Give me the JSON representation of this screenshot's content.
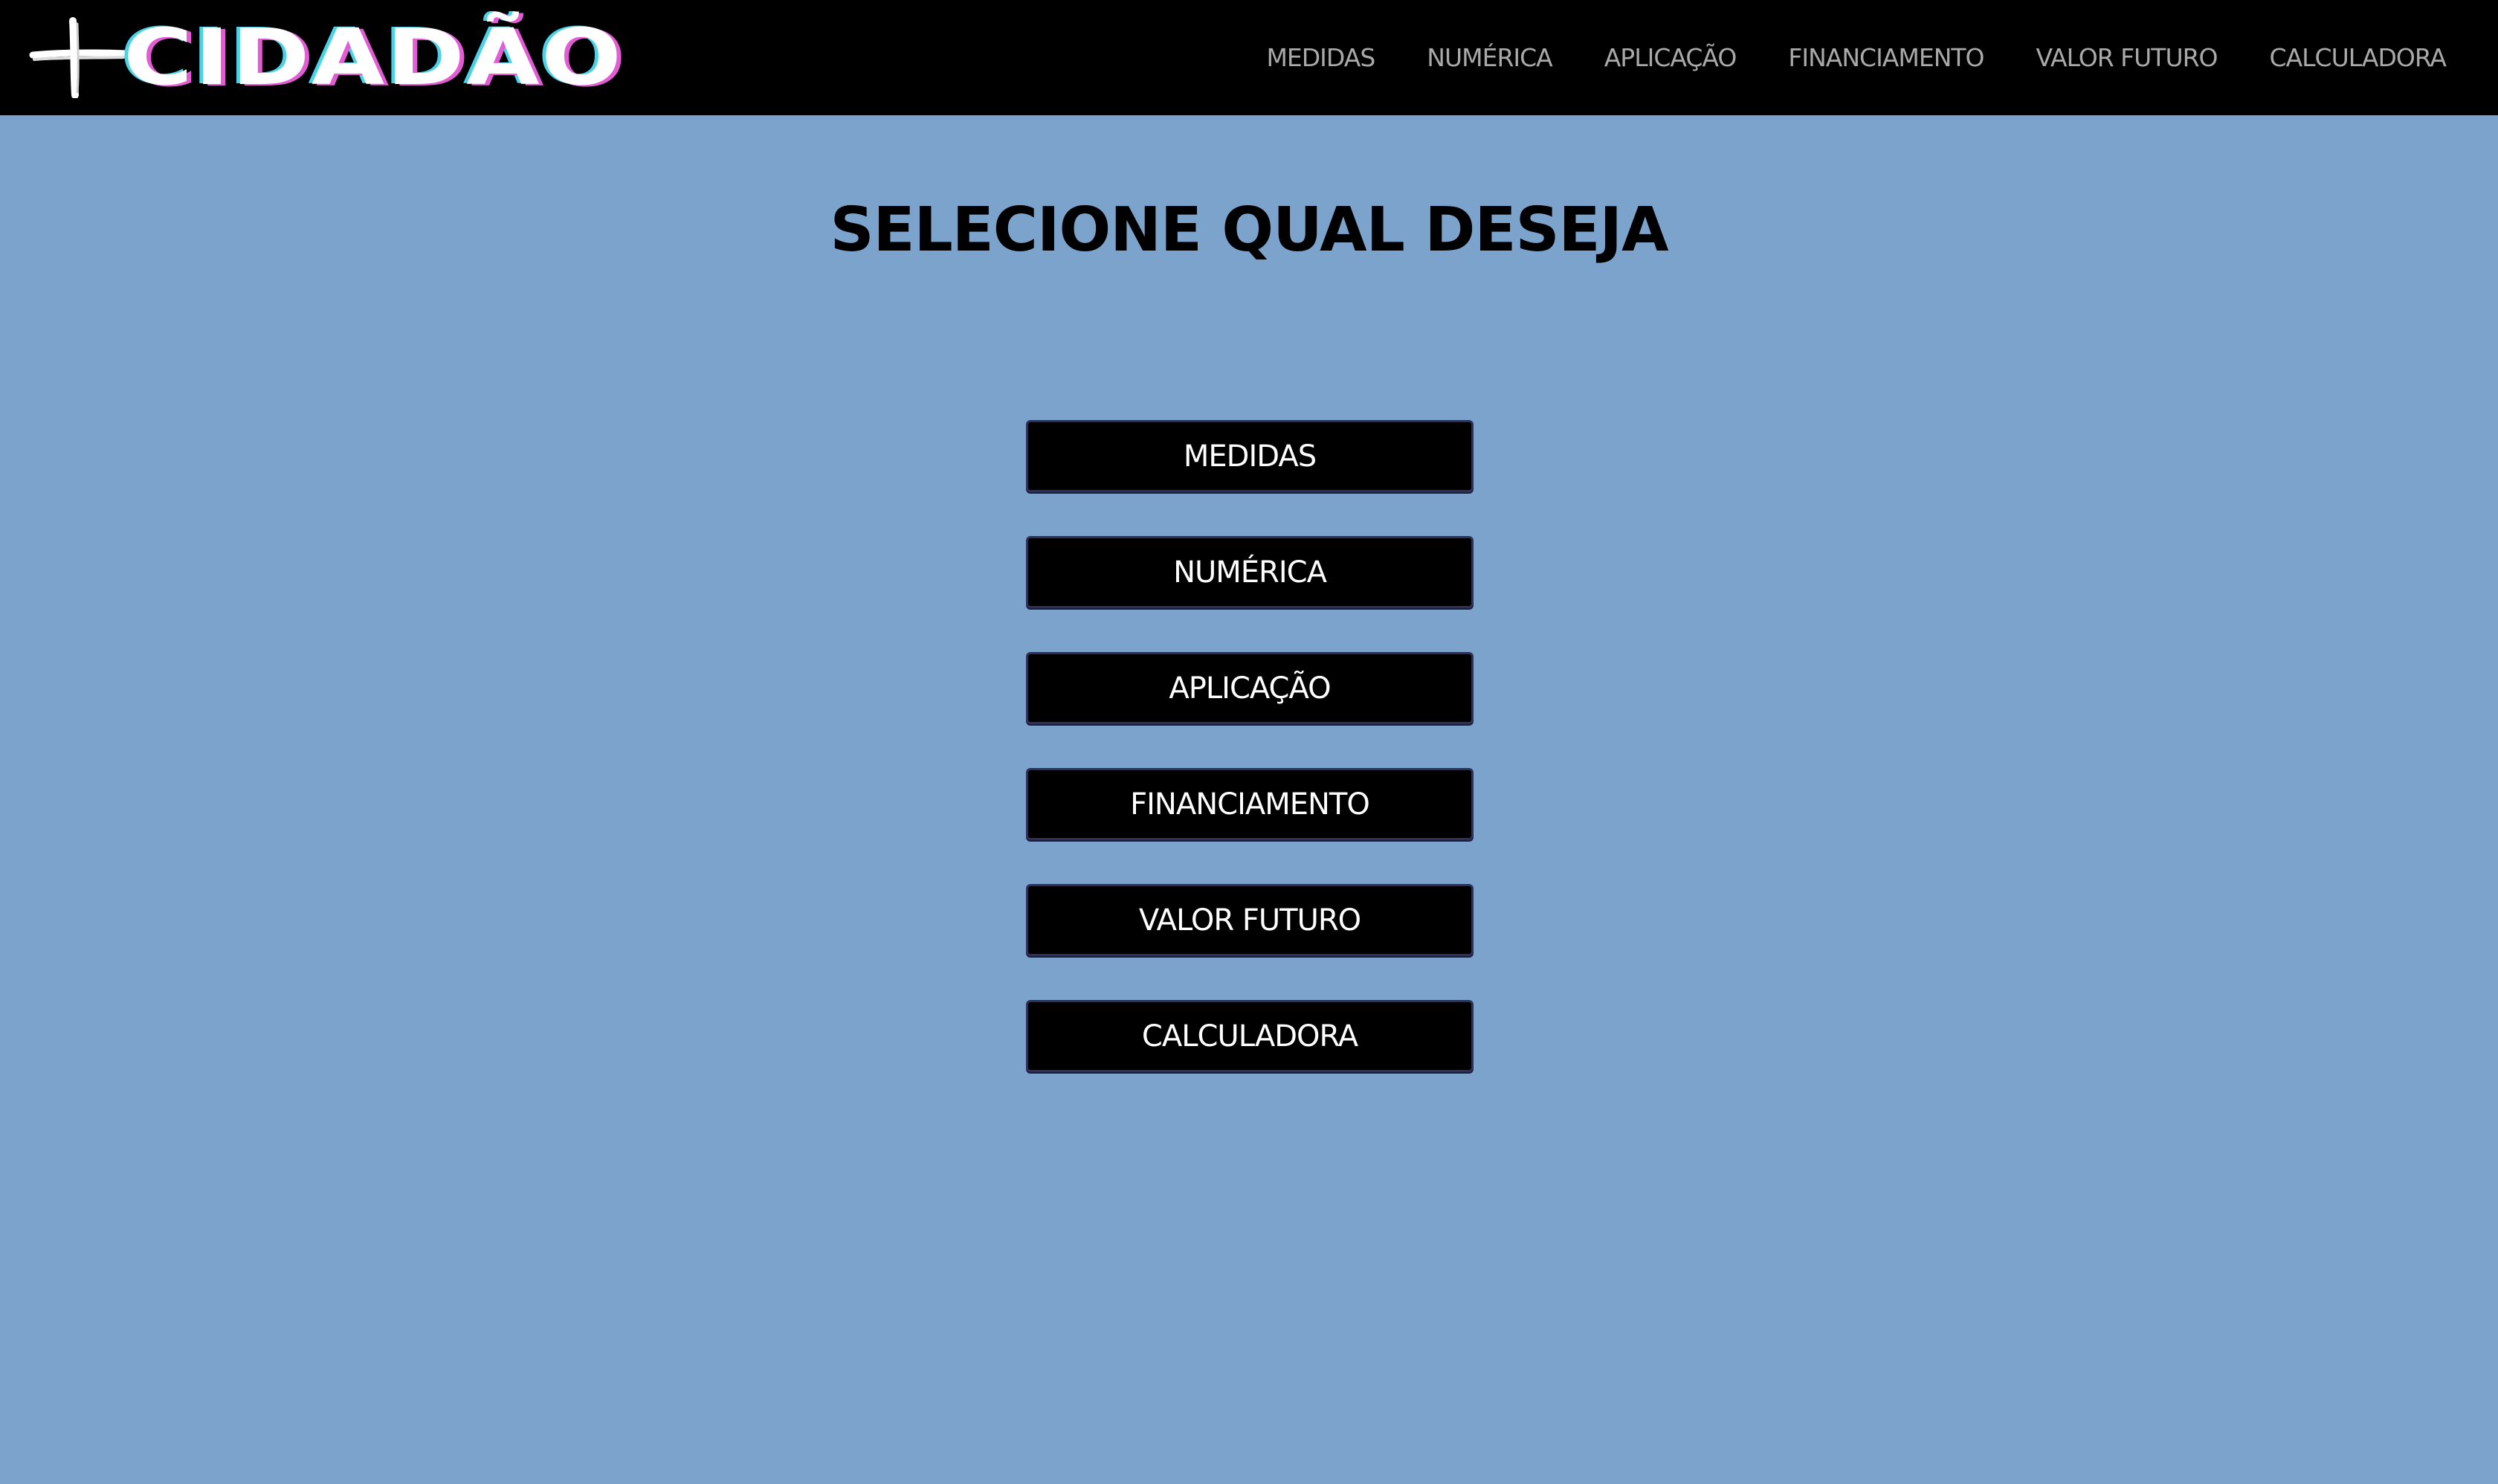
{
  "brand": {
    "logo_text": "CIDADÃO",
    "logo_icon": "plus-icon"
  },
  "nav": {
    "items": [
      {
        "label": "MEDIDAS"
      },
      {
        "label": "NUMÉRICA"
      },
      {
        "label": "APLICAÇÃO"
      },
      {
        "label": "FINANCIAMENTO"
      },
      {
        "label": "VALOR FUTURO"
      },
      {
        "label": "CALCULADORA"
      }
    ]
  },
  "main": {
    "title": "SELECIONE QUAL DESEJA",
    "buttons": [
      {
        "label": "MEDIDAS"
      },
      {
        "label": "NUMÉRICA"
      },
      {
        "label": "APLICAÇÃO"
      },
      {
        "label": "FINANCIAMENTO"
      },
      {
        "label": "VALOR FUTURO"
      },
      {
        "label": "CALCULADORA"
      }
    ]
  },
  "colors": {
    "background": "#7ba3cb",
    "navbar": "#000000",
    "nav_text": "#a9a9a9",
    "button_bg": "#000000",
    "button_text": "#ffffff",
    "logo_shadow_pink": "#e45bd6",
    "logo_shadow_cyan": "#49d2e8"
  }
}
